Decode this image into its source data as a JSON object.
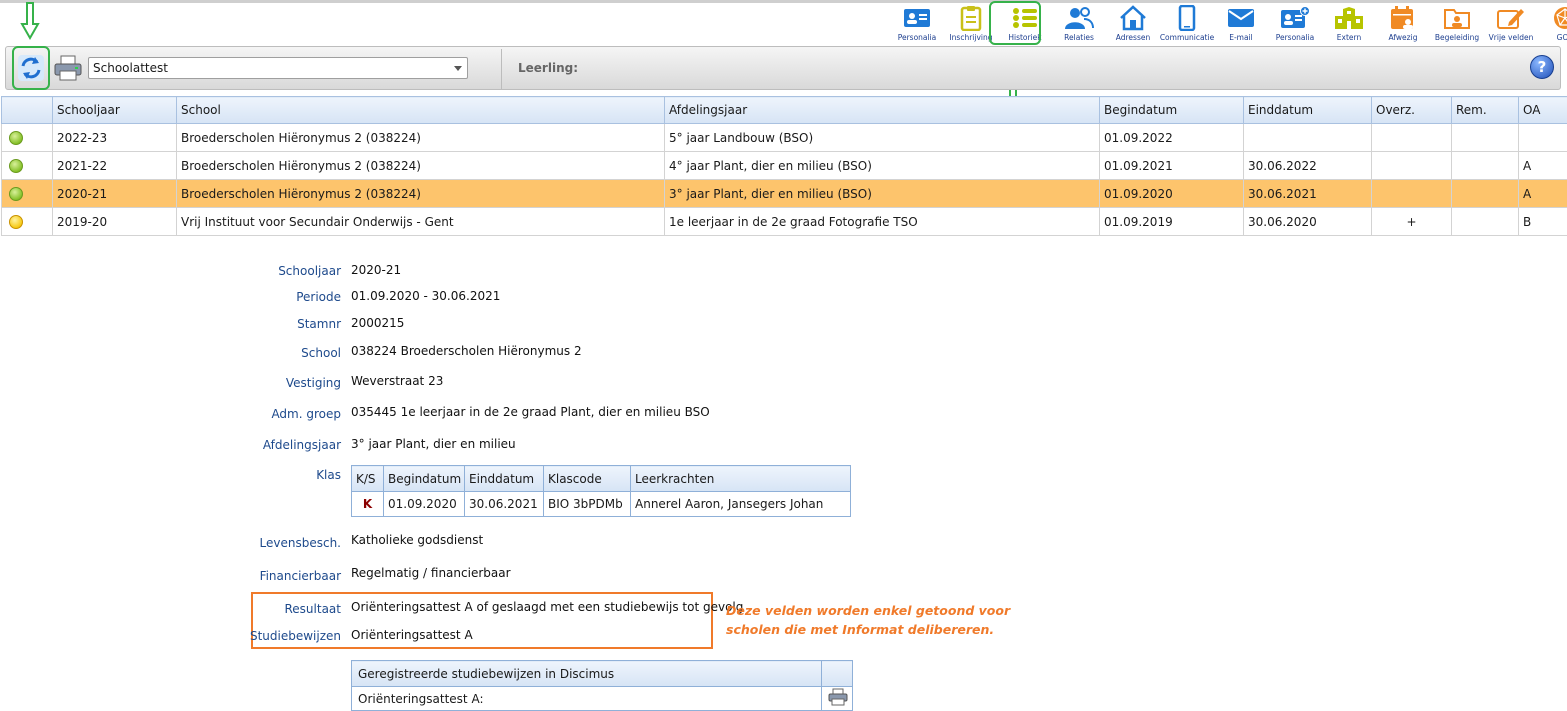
{
  "nav": [
    {
      "label": "Personalia",
      "icon": "id-card-icon",
      "color": "#1f7ad6"
    },
    {
      "label": "Inschrijving",
      "icon": "clipboard-icon",
      "color": "#c9c019"
    },
    {
      "label": "Historiek",
      "icon": "list-icon",
      "color": "#b7c400"
    },
    {
      "label": "Relaties",
      "icon": "people-icon",
      "color": "#1f7ad6"
    },
    {
      "label": "Adressen",
      "icon": "house-icon",
      "color": "#1f7ad6"
    },
    {
      "label": "Communicatie",
      "icon": "phone-icon",
      "color": "#1f7ad6"
    },
    {
      "label": "E-mail",
      "icon": "envelope-icon",
      "color": "#1f7ad6"
    },
    {
      "label": "Personalia",
      "icon": "id-card-plus-icon",
      "color": "#1f7ad6"
    },
    {
      "label": "Extern",
      "icon": "building-icon",
      "color": "#b7c400"
    },
    {
      "label": "Afwezig",
      "icon": "calendar-person-icon",
      "color": "#f08a24"
    },
    {
      "label": "Begeleiding",
      "icon": "folder-person-icon",
      "color": "#f08a24"
    },
    {
      "label": "Vrije velden",
      "icon": "pencil-form-icon",
      "color": "#f08a24"
    },
    {
      "label": "GOK",
      "icon": "network-icon",
      "color": "#f08a24"
    }
  ],
  "toolbar": {
    "select_value": "Schoolattest",
    "leerling_label": "Leerling:",
    "help_label": "?"
  },
  "grid": {
    "columns": [
      "",
      "Schooljaar",
      "School",
      "Afdelingsjaar",
      "Begindatum",
      "Einddatum",
      "Overz.",
      "Rem.",
      "OA"
    ],
    "rows": [
      {
        "status": "green",
        "schooljaar": "2022-23",
        "school": "Broederscholen Hiëronymus 2 (038224)",
        "afdelingsjaar": "5° jaar Landbouw (BSO)",
        "begindatum": "01.09.2022",
        "einddatum": "",
        "overz": "",
        "rem": "",
        "oa": ""
      },
      {
        "status": "green",
        "schooljaar": "2021-22",
        "school": "Broederscholen Hiëronymus 2 (038224)",
        "afdelingsjaar": "4° jaar Plant, dier en milieu (BSO)",
        "begindatum": "01.09.2021",
        "einddatum": "30.06.2022",
        "overz": "",
        "rem": "",
        "oa": "A"
      },
      {
        "status": "green",
        "schooljaar": "2020-21",
        "school": "Broederscholen Hiëronymus 2 (038224)",
        "afdelingsjaar": "3° jaar Plant, dier en milieu (BSO)",
        "begindatum": "01.09.2020",
        "einddatum": "30.06.2021",
        "overz": "",
        "rem": "",
        "oa": "A",
        "selected": true
      },
      {
        "status": "yellow",
        "schooljaar": "2019-20",
        "school": "Vrij Instituut voor Secundair Onderwijs - Gent",
        "afdelingsjaar": "1e leerjaar in de 2e graad Fotografie TSO",
        "begindatum": "01.09.2019",
        "einddatum": "30.06.2020",
        "overz": "+",
        "rem": "",
        "oa": "B"
      }
    ]
  },
  "detail": {
    "schooljaar": {
      "label": "Schooljaar",
      "value": "2020-21"
    },
    "periode": {
      "label": "Periode",
      "value": "01.09.2020 - 30.06.2021"
    },
    "stamnr": {
      "label": "Stamnr",
      "value": "2000215"
    },
    "school": {
      "label": "School",
      "value": "038224 Broederscholen Hiëronymus 2"
    },
    "vestiging": {
      "label": "Vestiging",
      "value": "Weverstraat 23"
    },
    "adm_groep": {
      "label": "Adm. groep",
      "value": "035445  1e leerjaar in de 2e graad Plant, dier en milieu BSO"
    },
    "afdelingsjaar": {
      "label": "Afdelingsjaar",
      "value": "3° jaar Plant, dier en milieu"
    },
    "klas_label": "Klas",
    "levensbesch": {
      "label": "Levensbesch.",
      "value": "Katholieke godsdienst"
    },
    "financierbaar": {
      "label": "Financierbaar",
      "value": "Regelmatig / financierbaar"
    },
    "resultaat": {
      "label": "Resultaat",
      "value": "Oriënteringsattest A of geslaagd met een studiebewijs tot gevolg"
    },
    "studiebewijzen": {
      "label": "Studiebewijzen",
      "value": "Oriënteringsattest A"
    }
  },
  "klas": {
    "columns": [
      "K/S",
      "Begindatum",
      "Einddatum",
      "Klascode",
      "Leerkrachten"
    ],
    "row": {
      "ks": "K",
      "begindatum": "01.09.2020",
      "einddatum": "30.06.2021",
      "klascode": "BIO 3bPDMb",
      "leerkrachten": "Annerel Aaron, Jansegers Johan"
    }
  },
  "note": {
    "line1": "Deze velden worden enkel getoond voor",
    "line2": "scholen die met Informat delibereren."
  },
  "discimus": {
    "header": "Geregistreerde studiebewijzen in Discimus",
    "row_label": "Oriënteringsattest A:"
  },
  "colors": {
    "highlight_green": "#36b24a",
    "highlight_orange": "#f07a2a",
    "selected_row": "#fdc46c",
    "label_blue": "#1e4a8c"
  }
}
